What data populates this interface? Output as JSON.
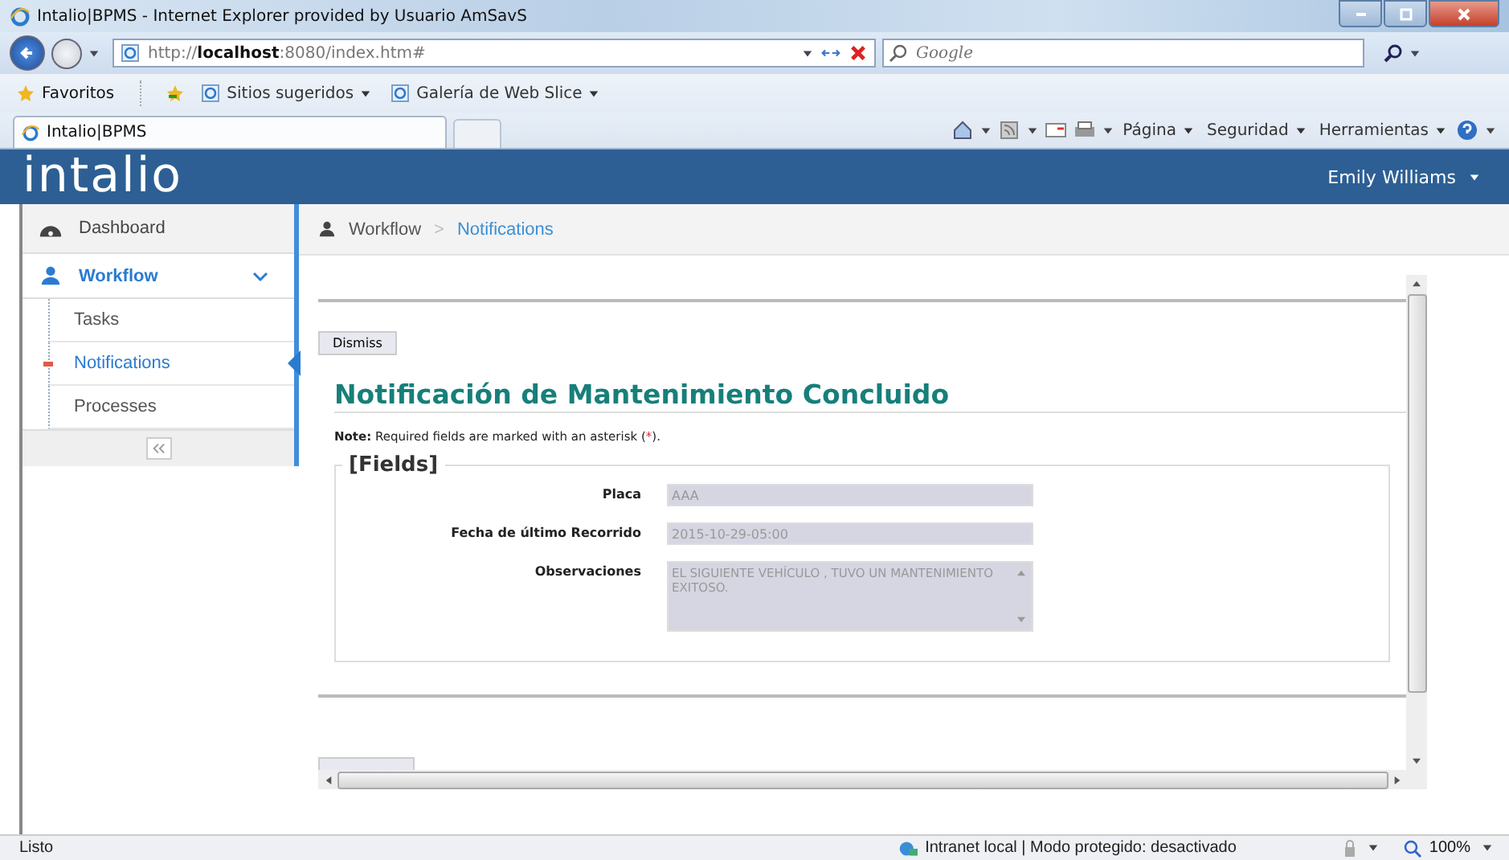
{
  "window": {
    "title": "Intalio|BPMS - Internet Explorer provided by Usuario AmSavS"
  },
  "address_bar": {
    "url": "http://**localhost**:8080/index.htm#"
  },
  "search": {
    "placeholder": "Google"
  },
  "favorites_bar": {
    "label": "Favoritos",
    "items": [
      "Sitios sugeridos",
      "Galería de Web Slice"
    ]
  },
  "tabs": [
    {
      "label": "Intalio|BPMS",
      "selected": true
    }
  ],
  "command_bar": [
    "Página",
    "Seguridad",
    "Herramientas"
  ],
  "app": {
    "logo": "intalio",
    "user": "Emily Williams"
  },
  "sidebar": {
    "items": [
      {
        "label": "Dashboard",
        "kind": "top"
      },
      {
        "label": "Workflow",
        "kind": "section",
        "expanded": true,
        "children": [
          {
            "label": "Tasks",
            "selected": false
          },
          {
            "label": "Notifications",
            "selected": true
          },
          {
            "label": "Processes",
            "selected": false
          }
        ]
      }
    ]
  },
  "breadcrumb": [
    "Workflow",
    "Notifications"
  ],
  "breadcrumb_separator": ">",
  "form": {
    "dismiss": "Dismiss",
    "title": "Notificación de Mantenimiento Concluido",
    "note": {
      "lead": "Note:",
      "before": " Required fields are marked with an asterisk (",
      "mark": "*",
      "after": ")."
    },
    "legend": "[Fields]",
    "fields": [
      {
        "label": "Placa",
        "value": "AAA",
        "kind": "text"
      },
      {
        "label": "Fecha de último Recorrido",
        "value": "2015-10-29-05:00",
        "kind": "text"
      },
      {
        "label": "Observaciones",
        "value": "EL SIGUIENTE VEHÍCULO , TUVO UN MANTENIMIENTO EXITOSO.",
        "kind": "textarea"
      }
    ]
  },
  "status_bar": {
    "text": "Listo",
    "zone": "Intranet local | Modo protegido: desactivado",
    "zoom": "100%"
  }
}
